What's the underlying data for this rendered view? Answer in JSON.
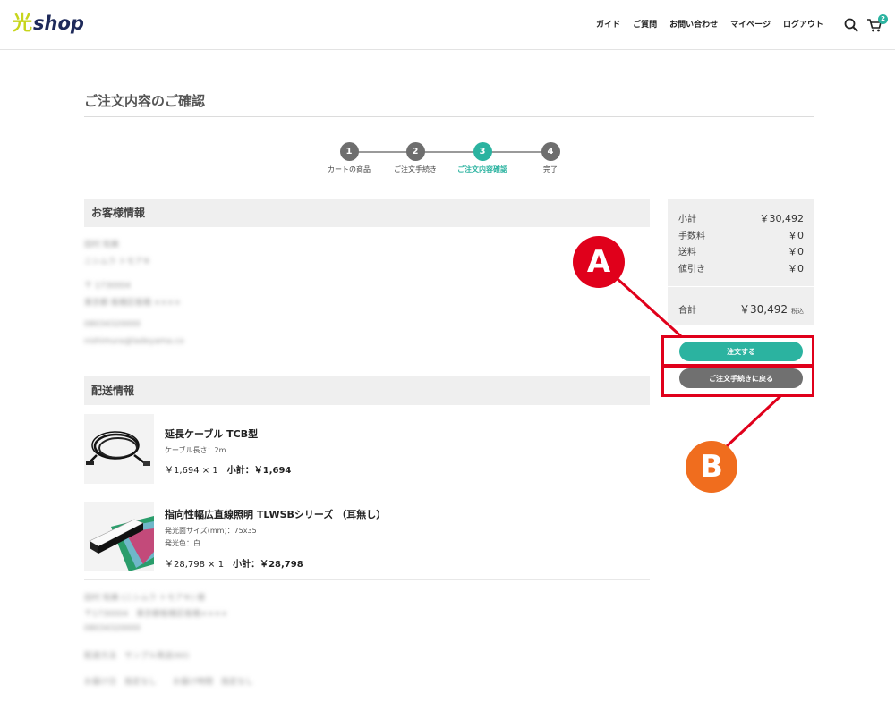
{
  "header": {
    "logo_kanji": "光",
    "logo_text": "shop",
    "nav": [
      "ガイド",
      "ご質問",
      "お問い合わせ",
      "マイページ",
      "ログアウト"
    ],
    "cart_count": "2",
    "icons": [
      "search-icon",
      "cart-icon"
    ]
  },
  "page": {
    "title": "ご注文内容のご確認"
  },
  "steps": [
    {
      "num": "1",
      "label": "カートの商品"
    },
    {
      "num": "2",
      "label": "ご注文手続き"
    },
    {
      "num": "3",
      "label": "ご注文内容確認"
    },
    {
      "num": "4",
      "label": "完了"
    }
  ],
  "active_step": 3,
  "customer": {
    "heading": "お客様情報",
    "lines": [
      "田村 知美",
      "ニシムラ トモアキ",
      "〒 1730004",
      "東京都 板橋区板橋 ××××",
      "08034320000",
      "nishimura@ladeyama.co"
    ]
  },
  "shipping": {
    "heading": "配送情報",
    "items": [
      {
        "name": "延長ケーブル TCB型",
        "specs": [
          "ケーブル長さ：2m"
        ],
        "price": "￥1,694 × 1",
        "subtotal": "小計：￥1,694"
      },
      {
        "name": "指向性幅広直線照明 TLWSBシリーズ （耳無し）",
        "specs": [
          "発光面サイズ(mm)：75x35",
          "発光色：白"
        ],
        "price": "￥28,798 × 1",
        "subtotal": "小計：￥28,798"
      }
    ],
    "footer_lines": [
      "田村 知美 (ニシムラ トモアキ) 様",
      "〒1730004　東京都板橋区板橋××××",
      "08034320000",
      "配達方法　サンプル発送(60)",
      "お届け日　指定なし　　お届け時間　指定なし"
    ]
  },
  "summary": {
    "rows": [
      {
        "label": "小計",
        "value": "￥30,492"
      },
      {
        "label": "手数料",
        "value": "￥0"
      },
      {
        "label": "送料",
        "value": "￥0"
      },
      {
        "label": "値引き",
        "value": "￥0"
      }
    ],
    "total_label": "合計",
    "total_value": "￥30,492",
    "tax_label": "税込"
  },
  "buttons": {
    "order": "注文する",
    "back": "ご注文手続きに戻る"
  },
  "annotations": {
    "a": "A",
    "b": "B"
  },
  "colors": {
    "accent": "#2bb3a0",
    "annotation_red": "#e0001b",
    "annotation_orange": "#f06d1e",
    "button_gray": "#707070"
  }
}
